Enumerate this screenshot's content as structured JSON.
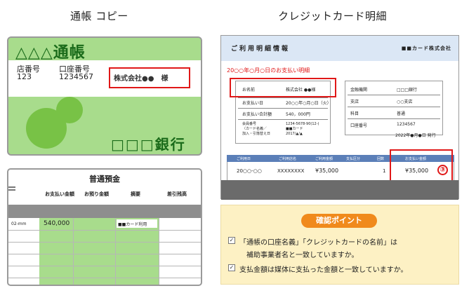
{
  "passbook": {
    "title": "通帳 コピー",
    "logo": "△△△通帳",
    "store_label": "店番号",
    "store_value": "123",
    "account_label": "口座番号",
    "account_value": "1234567",
    "holder_name": "株式会社●●　様",
    "bank_name": "□□□銀行"
  },
  "ledger": {
    "title": "普通預金",
    "headers": [
      "お支払い金額",
      "お預り金額",
      "摘要",
      "差引残高"
    ],
    "row": {
      "date": "02-mm",
      "amount": "540,000",
      "memo": "■■カード利用"
    }
  },
  "statement": {
    "title": "クレジットカード明細",
    "header_left": "ご利用明細情報",
    "header_right": "■■カード株式会社",
    "notice": "20○○年○月○日のお支払い明細",
    "left_rows": [
      {
        "label": "お名前",
        "value": "株式会社 ●●様"
      },
      {
        "label": "お支払い日",
        "value": "20○○年○月○日（火）"
      },
      {
        "label": "お支払い合計額",
        "value": "540，000円"
      },
      {
        "label": "会員番号\n（カード名義／\n加入・引落替え日",
        "value": "1234-5678-90(12-)\n■■カード\n2017/▲/▲"
      }
    ],
    "right_rows": [
      {
        "label": "金融機関",
        "value": "□□□銀行"
      },
      {
        "label": "支店",
        "value": "○○支店"
      },
      {
        "label": "科目",
        "value": "普通"
      },
      {
        "label": "口座番号",
        "value": "1234567"
      }
    ],
    "issue_date": "2022年●月●日 発行",
    "table_headers": [
      "ご利用日",
      "ご利用店名",
      "ご利用金額",
      "支払区分",
      "回数",
      "お支払い金額"
    ],
    "table_row": {
      "date": "20○○-○○",
      "store": "XXXXXXXX",
      "amount": "¥35,000",
      "count": "1",
      "payment": "¥35,000"
    },
    "marker": "③"
  },
  "check": {
    "title": "確認ポイント",
    "item1_line1": "「通帳の口座名義」「クレジットカードの名前」は",
    "item1_line2": "補助事業者名と一致していますか。",
    "item2": "支払金額は媒体に支払った金額と一致していますか。"
  }
}
